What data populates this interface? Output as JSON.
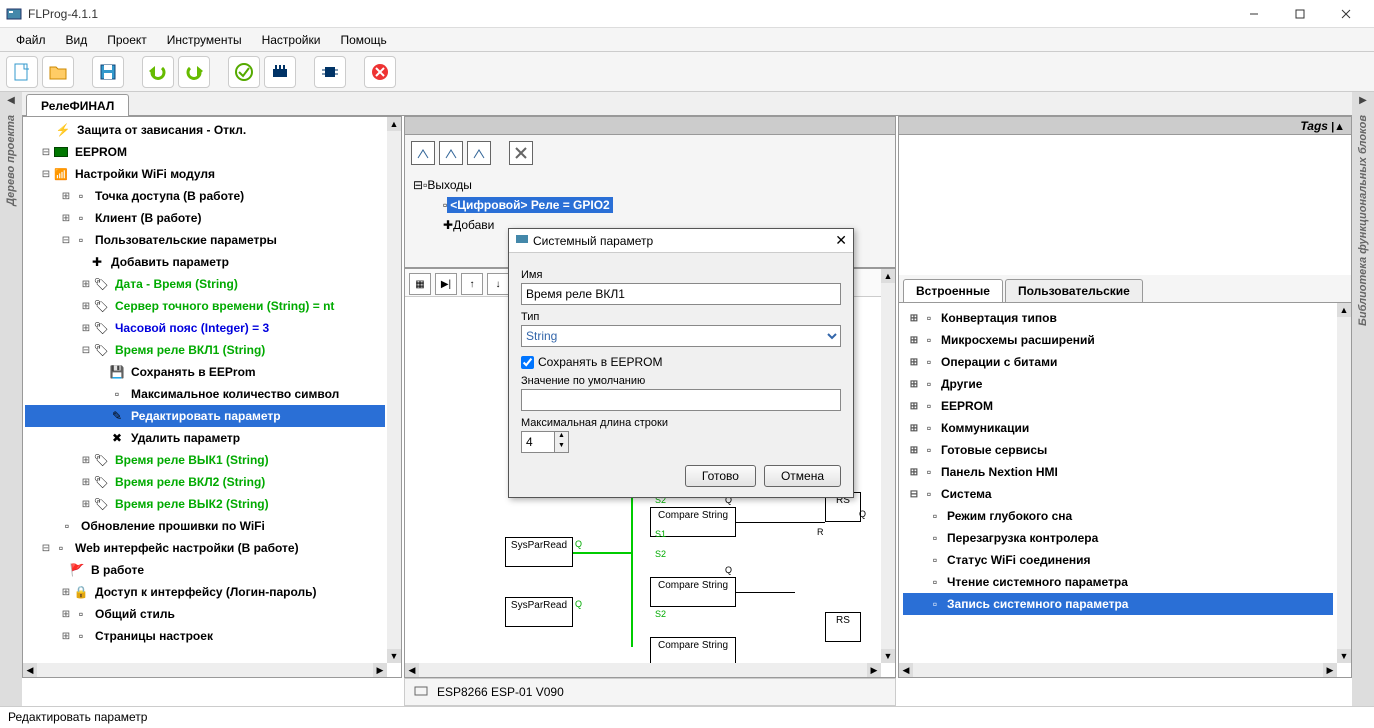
{
  "window": {
    "title": "FLProg-4.1.1"
  },
  "menu": [
    "Файл",
    "Вид",
    "Проект",
    "Инструменты",
    "Настройки",
    "Помощь"
  ],
  "tab": "РелеФИНАЛ",
  "leftrail": "Дерево проекта",
  "rightrail": "Библиотека функциональных блоков",
  "tree": {
    "n1": "Защита от зависания - Откл.",
    "n2": "EEPROM",
    "n3": "Настройки WiFi модуля",
    "n4": "Точка доступа (В работе)",
    "n5": "Клиент (В работе)",
    "n6": "Пользовательские параметры",
    "n7": "Добавить параметр",
    "n8": "Дата - Время (String)",
    "n9": "Сервер точного времени (String) = nt",
    "n10": "Часовой пояс (Integer) = 3",
    "n11": "Время реле ВКЛ1 (String)",
    "n12": "Сохранять в EEProm",
    "n13": "Максимальное количество символ",
    "n14": "Редактировать параметр",
    "n15": "Удалить параметр",
    "n16": "Время реле ВЫК1 (String)",
    "n17": "Время реле ВКЛ2 (String)",
    "n18": "Время реле ВЫК2 (String)",
    "n19": "Обновление прошивки по WiFi",
    "n20": "Web интерфейс настройки (В работе)",
    "n21": "В работе",
    "n22": "Доступ к интерфейсу (Логин-пароль)",
    "n23": "Общий стиль",
    "n24": "Страницы настроек"
  },
  "outputs": {
    "title": "Выходы",
    "gpio": "<Цифровой> Реле = GPIO2",
    "add": "Добави"
  },
  "rpanel": {
    "toptag": "Tags",
    "tab1": "Встроенные",
    "tab2": "Пользовательские",
    "i1": "Конвертация типов",
    "i2": "Микросхемы расширений",
    "i3": "Операции с битами",
    "i4": "Другие",
    "i5": "EEPROM",
    "i6": "Коммуникации",
    "i7": "Готовые сервисы",
    "i8": "Панель Nextion HMI",
    "i9": "Система",
    "s1": "Режим глубокого сна",
    "s2": "Перезагрузка контролера",
    "s3": "Статус WiFi соединения",
    "s4": "Чтение системного параметра",
    "s5": "Запись системного параметра"
  },
  "dialog": {
    "title": "Системный параметр",
    "l_name": "Имя",
    "v_name": "Время реле ВКЛ1",
    "l_type": "Тип",
    "v_type": "String",
    "chk": "Сохранять в EEPROM",
    "l_def": "Значение по умолчанию",
    "v_def": "",
    "l_max": "Максимальная длина строки",
    "v_max": "4",
    "ok": "Готово",
    "cancel": "Отмена"
  },
  "canvas": {
    "b1": "SysParRead",
    "b2": "Compare String",
    "b3": "SysParRead",
    "b4": "Compare String",
    "b5": "Compare String",
    "rs": "RS"
  },
  "status": "ESP8266 ESP-01 V090",
  "bottomstatus": "Редактировать параметр"
}
